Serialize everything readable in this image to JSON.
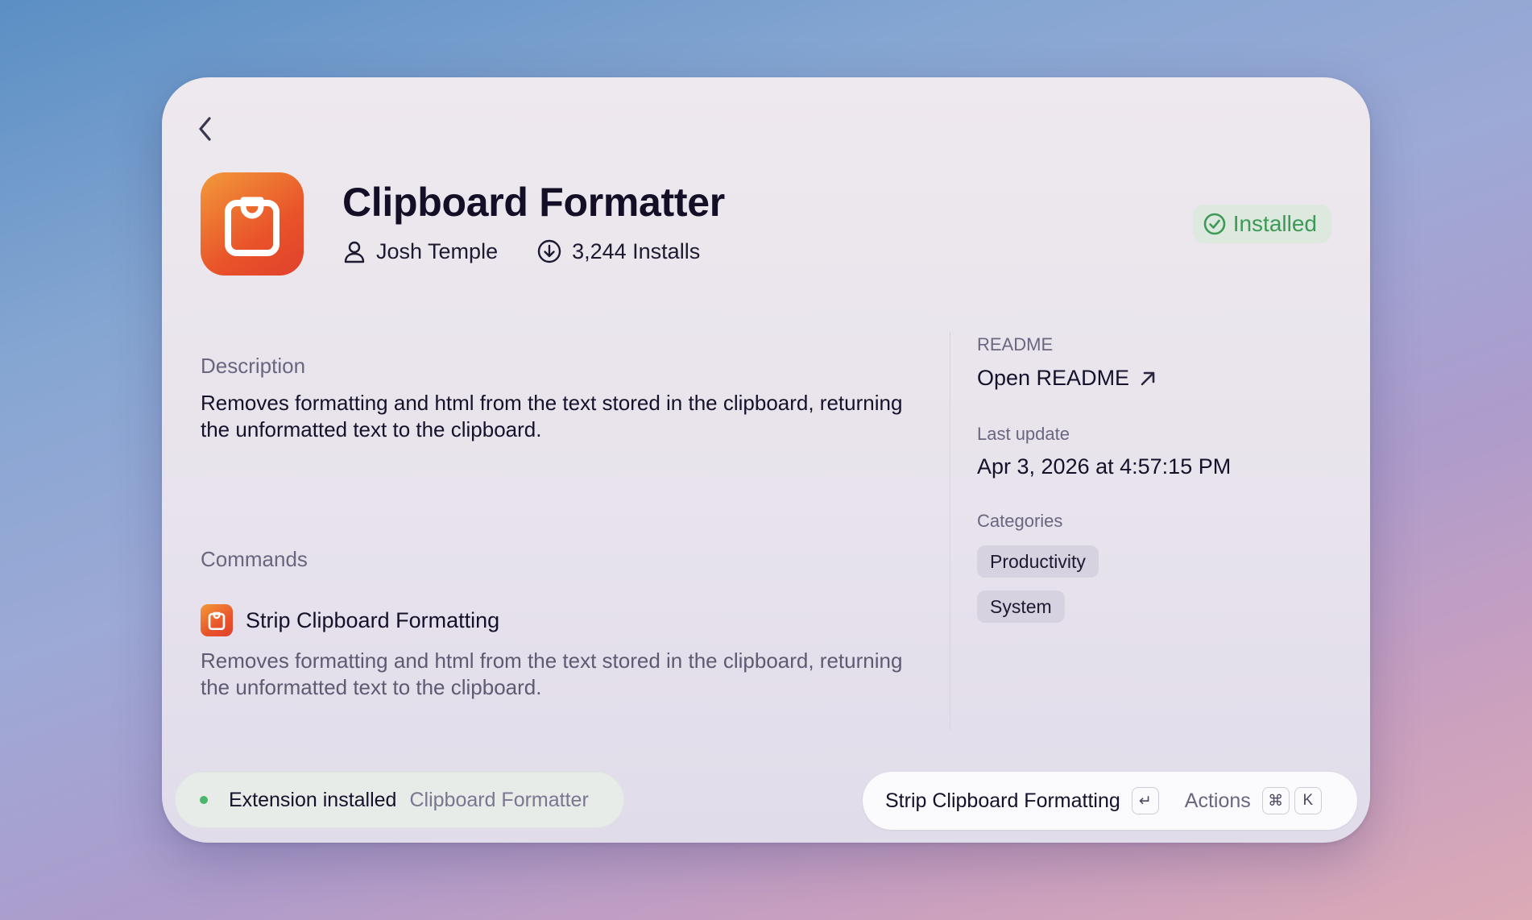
{
  "header": {
    "title": "Clipboard Formatter",
    "author": "Josh Temple",
    "installs": "3,244 Installs",
    "status": "Installed"
  },
  "description": {
    "label": "Description",
    "text": "Removes formatting and html from the text stored in the clipboard, returning the unformatted text to the clipboard."
  },
  "commands": {
    "label": "Commands",
    "items": [
      {
        "name": "Strip Clipboard Formatting",
        "description": "Removes formatting and html from the text stored in the clipboard, returning the unformatted text to the clipboard."
      }
    ]
  },
  "sidebar": {
    "readme_label": "README",
    "readme_link": "Open README",
    "last_update_label": "Last update",
    "last_update_value": "Apr 3, 2026 at 4:57:15 PM",
    "categories_label": "Categories",
    "categories": [
      "Productivity",
      "System"
    ]
  },
  "toast": {
    "title": "Extension installed",
    "subtitle": "Clipboard Formatter"
  },
  "action_bar": {
    "primary_label": "Strip Clipboard Formatting",
    "primary_key": "↵",
    "actions_label": "Actions",
    "actions_keys": [
      "⌘",
      "K"
    ]
  },
  "colors": {
    "accent_orange": "#e9542a",
    "success_green": "#3c9a56",
    "text_primary": "#15112a"
  },
  "icons": {
    "back": "chevron-left-icon",
    "app": "clipboard-icon",
    "author": "user-icon",
    "installs": "download-circle-icon",
    "status": "check-circle-icon",
    "readme": "arrow-up-right-icon"
  }
}
